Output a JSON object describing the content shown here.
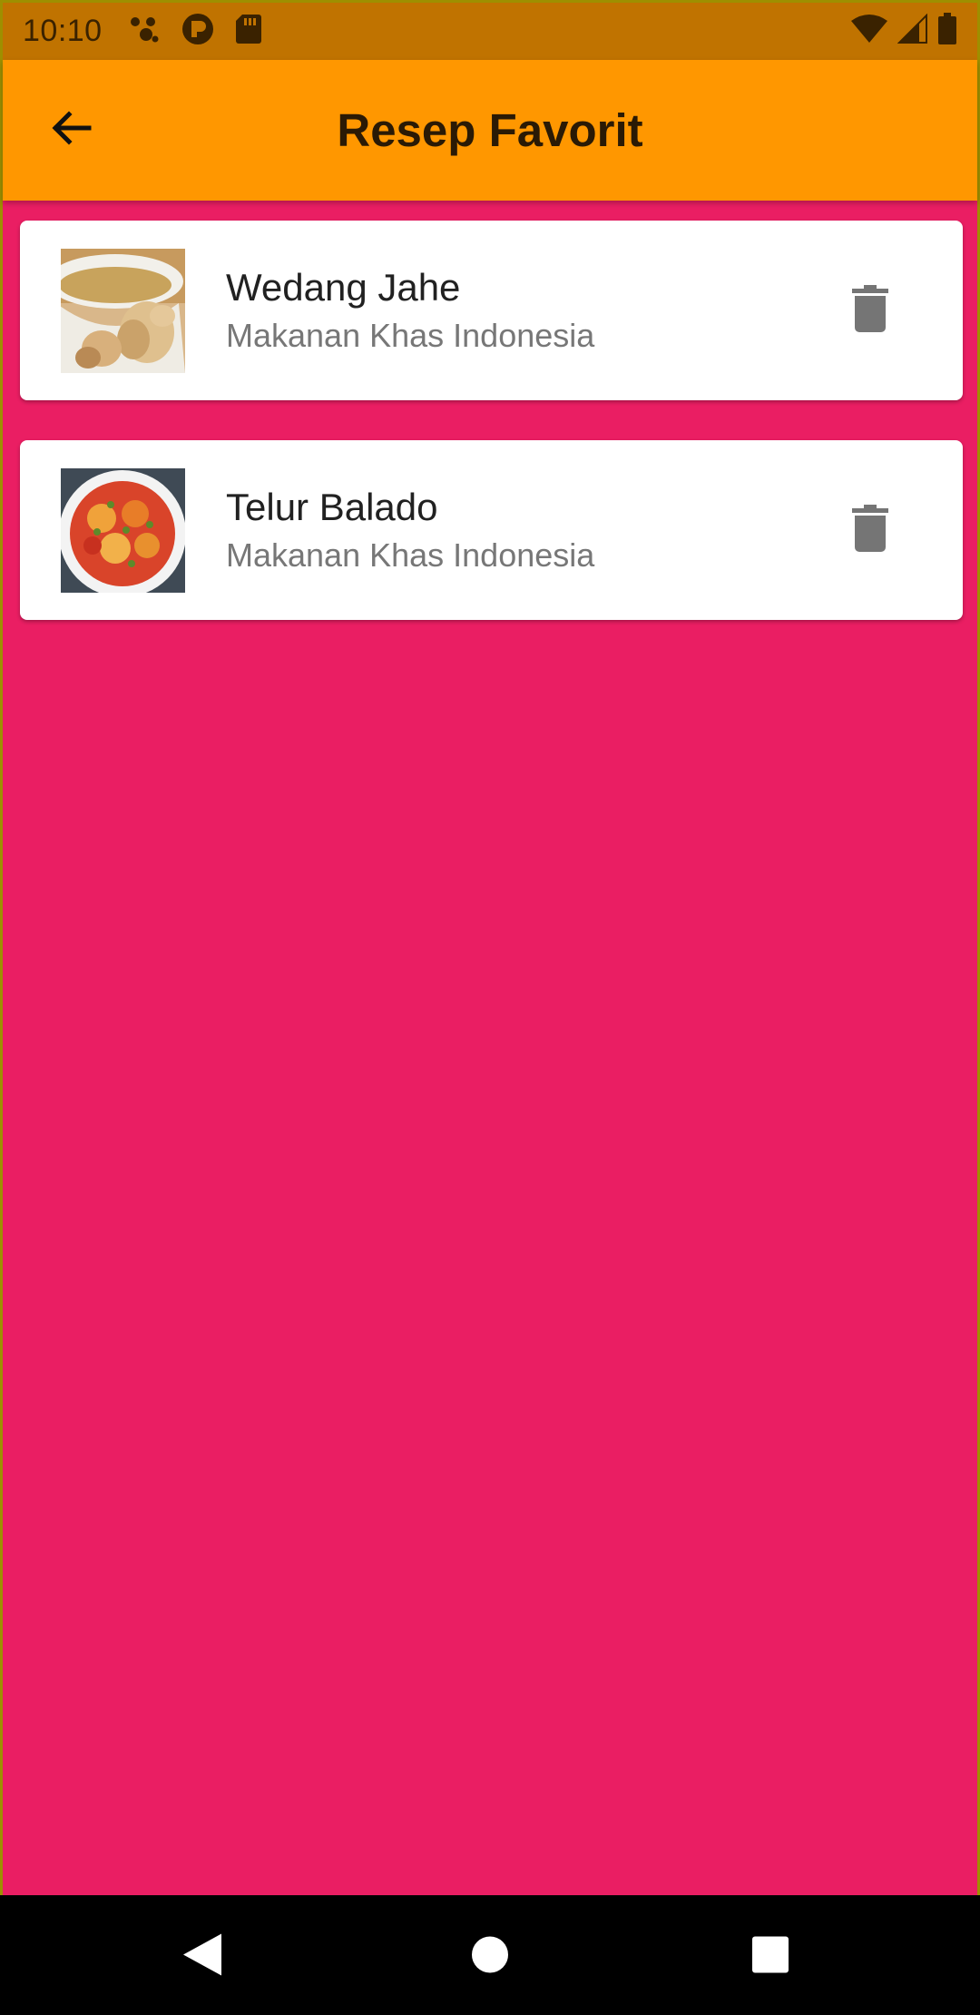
{
  "status_bar": {
    "time": "10:10",
    "left_icons": [
      "assistant-dots-icon",
      "notification-app-icon",
      "sd-card-icon"
    ],
    "right_icons": [
      "wifi-icon",
      "cell-signal-icon",
      "battery-icon"
    ]
  },
  "app_bar": {
    "title": "Resep Favorit",
    "back_icon": "arrow-back-icon"
  },
  "favorites": [
    {
      "title": "Wedang Jahe",
      "subtitle": "Makanan Khas Indonesia",
      "image": "ginger-drink-photo",
      "action_icon": "delete-icon"
    },
    {
      "title": "Telur Balado",
      "subtitle": "Makanan Khas Indonesia",
      "image": "balado-egg-photo",
      "action_icon": "delete-icon"
    }
  ],
  "colors": {
    "status_bar": "#c07300",
    "app_bar": "#ff9700",
    "background": "#ea1e63",
    "card": "#ffffff"
  },
  "nav_bar": {
    "buttons": [
      "back-triangle-icon",
      "home-circle-icon",
      "recents-square-icon"
    ]
  }
}
